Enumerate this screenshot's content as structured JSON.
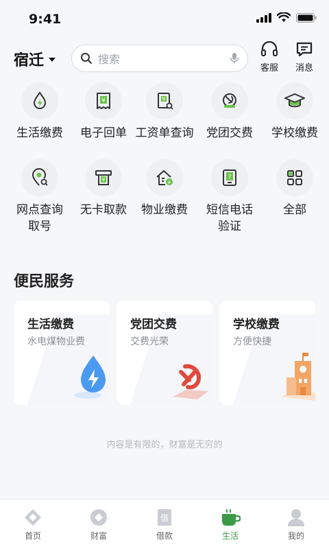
{
  "status_bar": {
    "time": "9:41"
  },
  "header": {
    "city": "宿迁",
    "search_placeholder": "搜索",
    "service_label": "客服",
    "message_label": "消息"
  },
  "services": [
    {
      "label": "生活缴费",
      "icon": "water-drop-bolt-icon"
    },
    {
      "label": "电子回单",
      "icon": "receipt-yuan-icon"
    },
    {
      "label": "工资单查询",
      "icon": "payslip-search-icon"
    },
    {
      "label": "党团交费",
      "icon": "party-emblem-icon"
    },
    {
      "label": "学校缴费",
      "icon": "graduation-cap-icon"
    },
    {
      "label": "网点查询\n取号",
      "icon": "location-search-icon"
    },
    {
      "label": "无卡取款",
      "icon": "atm-cash-icon"
    },
    {
      "label": "物业缴费",
      "icon": "home-coin-icon"
    },
    {
      "label": "短信电话\n验证",
      "icon": "tablet-question-icon"
    },
    {
      "label": "全部",
      "icon": "grid-apps-icon"
    }
  ],
  "convenience": {
    "title": "便民服务",
    "cards": [
      {
        "title": "生活缴费",
        "subtitle": "水电煤物业费"
      },
      {
        "title": "党团交费",
        "subtitle": "交费光荣"
      },
      {
        "title": "学校缴费",
        "subtitle": "方便快捷"
      }
    ]
  },
  "slogan": "内容是有限的，财富是无穷的",
  "tabbar": [
    {
      "label": "首页",
      "active": false
    },
    {
      "label": "财富",
      "active": false
    },
    {
      "label": "借款",
      "active": false
    },
    {
      "label": "生活",
      "active": true
    },
    {
      "label": "我的",
      "active": false
    }
  ],
  "colors": {
    "accent": "#3c9a46",
    "blue": "#3c8fe8",
    "red": "#e0493d",
    "orange": "#f0a25e"
  }
}
